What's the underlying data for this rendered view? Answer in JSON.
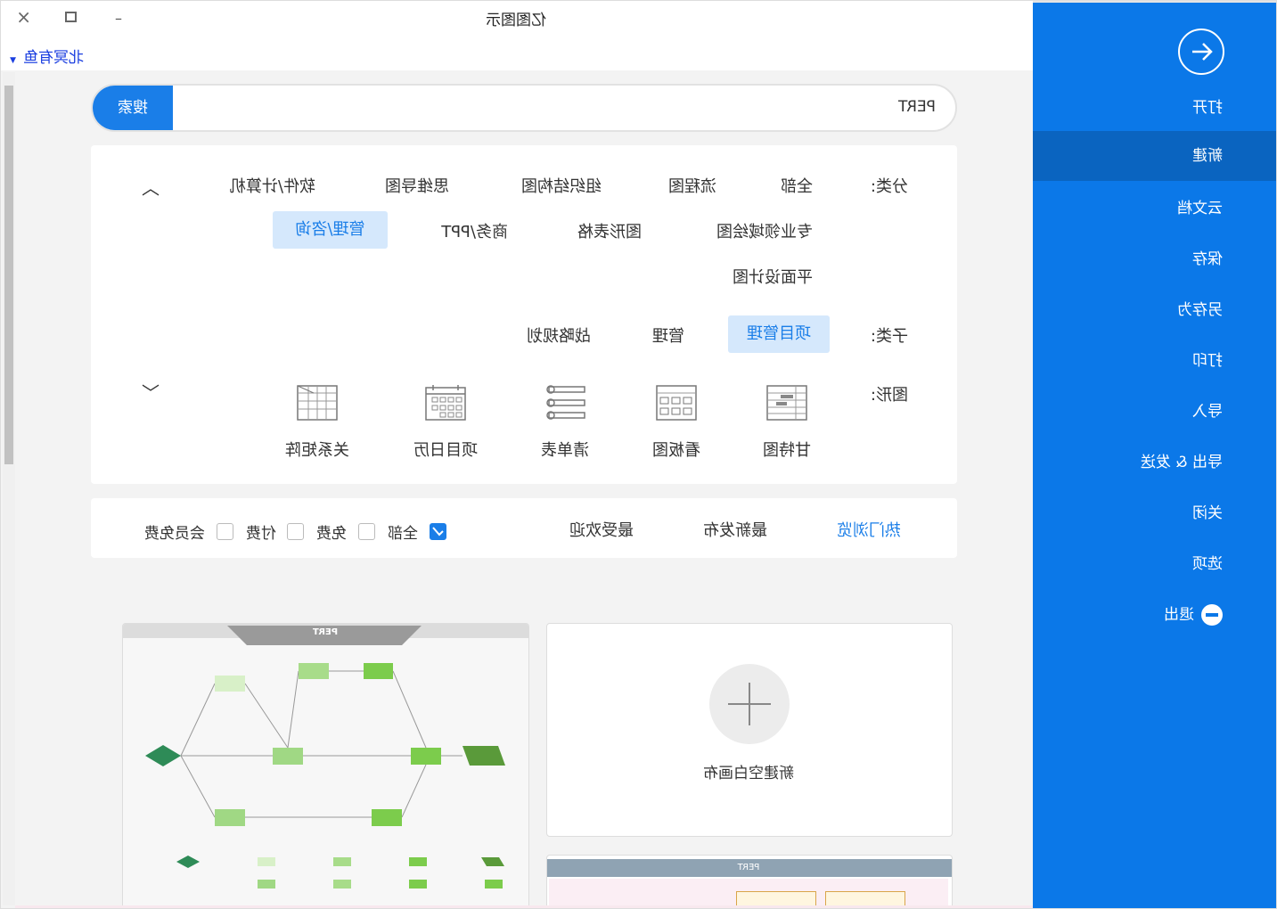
{
  "window": {
    "title": "亿图图示",
    "user": "北冥有鱼"
  },
  "sidebar": {
    "items": [
      {
        "label": "打开",
        "icon": "back-arrow-icon"
      },
      {
        "label": "新建",
        "selected": true
      },
      {
        "label": "云文档"
      },
      {
        "label": "保存"
      },
      {
        "label": "另存为"
      },
      {
        "label": "打印"
      },
      {
        "label": "导入"
      },
      {
        "label": "导出 & 发送"
      },
      {
        "label": "关闭"
      },
      {
        "label": "选项"
      },
      {
        "label": "退出",
        "icon": "minus-circle-icon"
      }
    ],
    "accent": "#0b78e8",
    "selected_bg": "#0a64c0"
  },
  "search": {
    "value": "PERT",
    "button": "搜索"
  },
  "category": {
    "label": "分类:",
    "items": [
      "全部",
      "流程图",
      "组织结构图",
      "思维导图",
      "软件/计算机",
      "专业领域绘图",
      "图形表格",
      "商务/PPT",
      "管理/咨询",
      "平面设计图"
    ],
    "selected": "管理/咨询"
  },
  "subcategory": {
    "label": "子类:",
    "items": [
      "项目管理",
      "管理",
      "战略规划"
    ],
    "selected": "项目管理"
  },
  "shapes": {
    "label": "图形:",
    "items": [
      {
        "label": "甘特图",
        "icon": "gantt-icon"
      },
      {
        "label": "看板图",
        "icon": "kanban-icon"
      },
      {
        "label": "清单表",
        "icon": "checklist-icon"
      },
      {
        "label": "项目日历",
        "icon": "calendar-icon"
      },
      {
        "label": "关系矩阵",
        "icon": "matrix-icon"
      }
    ]
  },
  "filter": {
    "tabs": [
      "热门浏览",
      "最新发布",
      "最受欢迎"
    ],
    "active_tab": "热门浏览",
    "checks": [
      {
        "label": "全部",
        "checked": true
      },
      {
        "label": "免费",
        "checked": false
      },
      {
        "label": "付费",
        "checked": false
      },
      {
        "label": "会员免费",
        "checked": false
      }
    ]
  },
  "templates": {
    "pert_title": "PERT",
    "blank_label": "新建空白画布",
    "third_title": "PERT"
  }
}
